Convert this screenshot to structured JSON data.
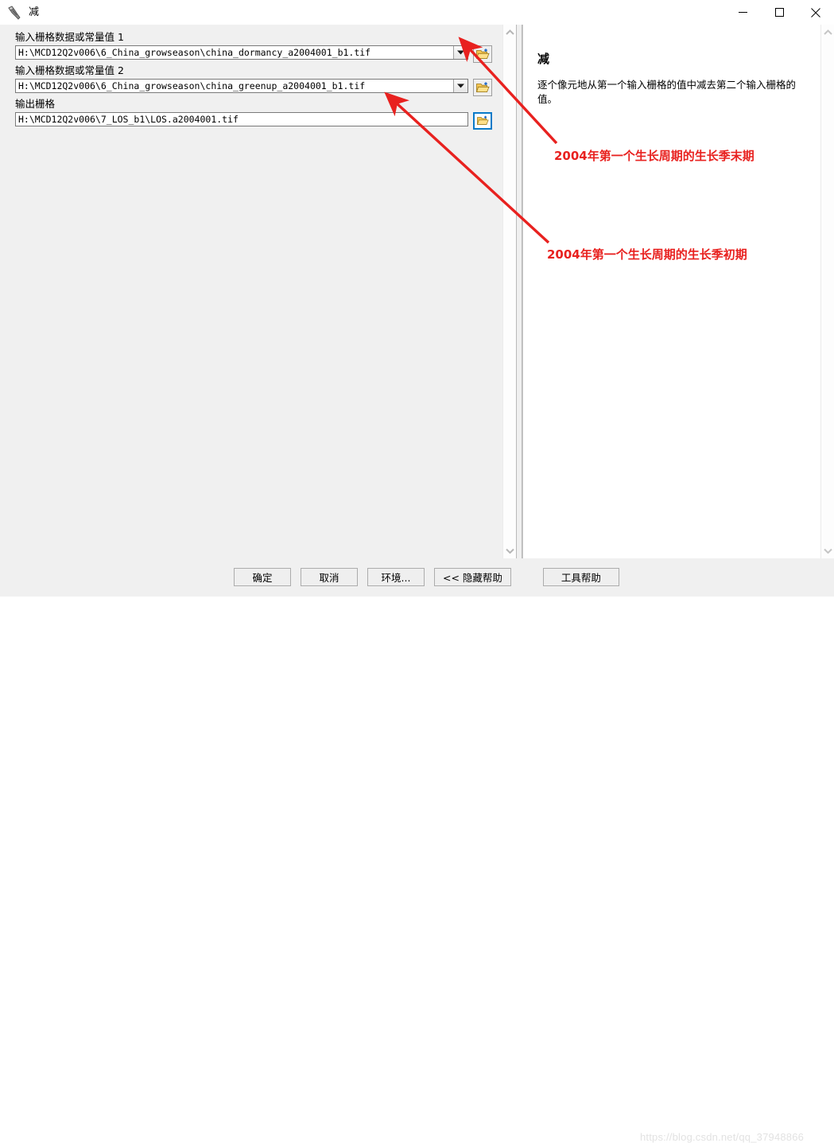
{
  "window": {
    "title": "减",
    "icon": "hammer-icon",
    "controls": {
      "minimize": "minimize-icon",
      "maximize": "maximize-icon",
      "close": "close-icon"
    }
  },
  "parameters": [
    {
      "label": "输入栅格数据或常量值  1",
      "value": "H:\\MCD12Q2v006\\6_China_growseason\\china_dormancy_a2004001_b1.tif",
      "has_dropdown": true,
      "browse_icon": "open-folder-icon",
      "browse_focused": false
    },
    {
      "label": "输入栅格数据或常量值  2",
      "value": "H:\\MCD12Q2v006\\6_China_growseason\\china_greenup_a2004001_b1.tif",
      "has_dropdown": true,
      "browse_icon": "open-folder-icon",
      "browse_focused": false
    },
    {
      "label": "输出栅格",
      "value": "H:\\MCD12Q2v006\\7_LOS_b1\\LOS.a2004001.tif",
      "has_dropdown": false,
      "browse_icon": "open-folder-icon",
      "browse_focused": true
    }
  ],
  "help": {
    "title": "减",
    "description": "逐个像元地从第一个输入栅格的值中减去第二个输入栅格的值。"
  },
  "footer": {
    "ok": "确定",
    "cancel": "取消",
    "environments": "环境...",
    "hide_help": "<< 隐藏帮助",
    "tool_help": "工具帮助"
  },
  "annotations": [
    {
      "text": "2004年第一个生长周期的生长季末期",
      "color": "#e8211f"
    },
    {
      "text": "2004年第一个生长周期的生长季初期",
      "color": "#e8211f"
    }
  ],
  "watermark": "https://blog.csdn.net/qq_37948866",
  "scrollbars": {
    "left_up": "chevron-up-icon",
    "left_down": "chevron-down-icon",
    "right_up": "chevron-up-icon",
    "right_down": "chevron-down-icon"
  }
}
